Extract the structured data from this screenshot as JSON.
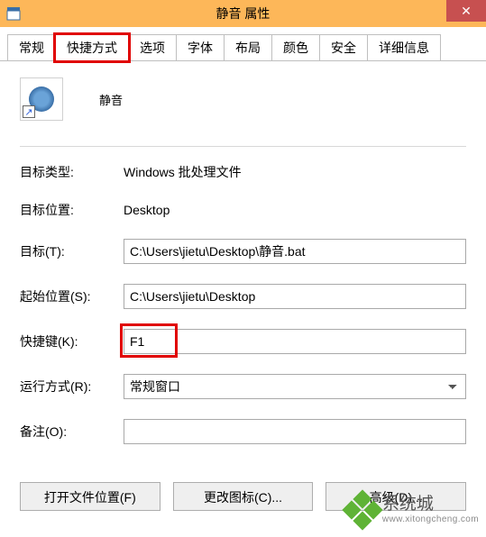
{
  "window": {
    "title": "静音 属性",
    "close": "✕"
  },
  "tabs": [
    {
      "label": "常规"
    },
    {
      "label": "快捷方式"
    },
    {
      "label": "选项"
    },
    {
      "label": "字体"
    },
    {
      "label": "布局"
    },
    {
      "label": "颜色"
    },
    {
      "label": "安全"
    },
    {
      "label": "详细信息"
    }
  ],
  "app_name": "静音",
  "fields": {
    "target_type_label": "目标类型:",
    "target_type_value": "Windows 批处理文件",
    "target_loc_label": "目标位置:",
    "target_loc_value": "Desktop",
    "target_label": "目标(T):",
    "target_value": "C:\\Users\\jietu\\Desktop\\静音.bat",
    "startin_label": "起始位置(S):",
    "startin_value": "C:\\Users\\jietu\\Desktop",
    "shortcut_label": "快捷键(K):",
    "shortcut_value": "F1",
    "run_label": "运行方式(R):",
    "run_value": "常规窗口",
    "comment_label": "备注(O):",
    "comment_value": ""
  },
  "buttons": {
    "open_loc": "打开文件位置(F)",
    "change_icon": "更改图标(C)...",
    "advanced": "高级(D)..."
  },
  "watermark": {
    "brand": "系统城",
    "url": "www.xitongcheng.com"
  }
}
